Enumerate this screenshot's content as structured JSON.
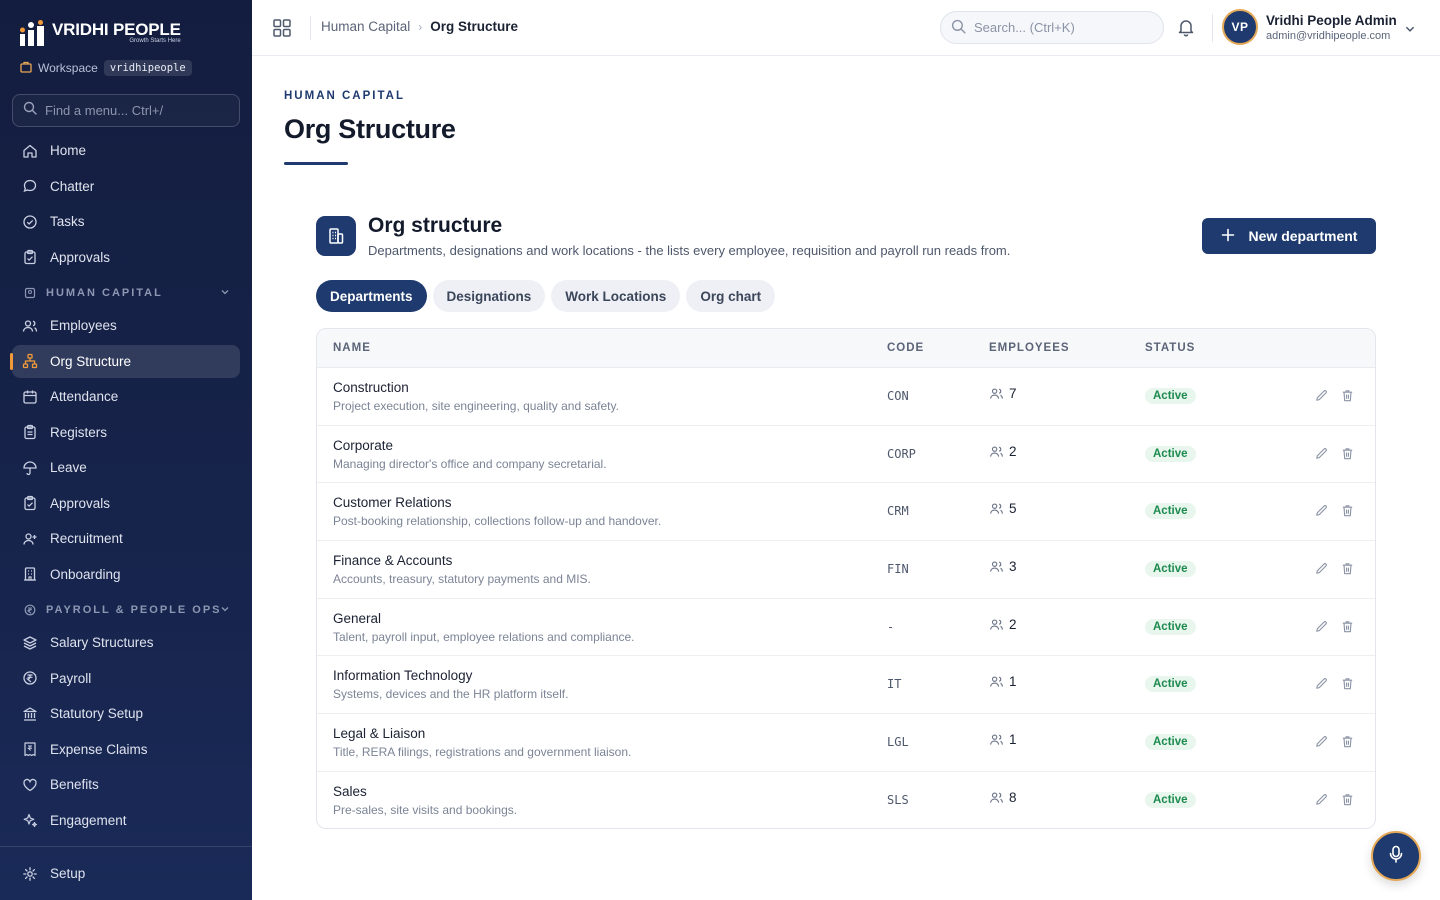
{
  "brand": {
    "name": "VRIDHI PEOPLE",
    "tagline": "Growth Starts Here"
  },
  "workspace": {
    "label": "Workspace",
    "slug": "vridhipeople"
  },
  "sidebar": {
    "search_placeholder": "Find a menu... Ctrl+/",
    "items_top": [
      {
        "label": "Home",
        "icon": "home-icon"
      },
      {
        "label": "Chatter",
        "icon": "chat-icon"
      },
      {
        "label": "Tasks",
        "icon": "check-circle-icon"
      },
      {
        "label": "Approvals",
        "icon": "clipboard-icon"
      }
    ],
    "section_hc": "HUMAN CAPITAL",
    "items_hc": [
      {
        "label": "Employees",
        "icon": "users-icon"
      },
      {
        "label": "Org Structure",
        "icon": "org-icon",
        "active": true
      },
      {
        "label": "Attendance",
        "icon": "calendar-icon"
      },
      {
        "label": "Registers",
        "icon": "clipboard-icon"
      },
      {
        "label": "Leave",
        "icon": "umbrella-icon"
      },
      {
        "label": "Approvals",
        "icon": "clipboard-icon"
      },
      {
        "label": "Recruitment",
        "icon": "user-plus-icon"
      },
      {
        "label": "Onboarding",
        "icon": "building-icon"
      }
    ],
    "section_pp": "PAYROLL & PEOPLE OPS",
    "items_pp": [
      {
        "label": "Salary Structures",
        "icon": "layers-icon"
      },
      {
        "label": "Payroll",
        "icon": "rupee-icon"
      },
      {
        "label": "Statutory Setup",
        "icon": "bank-icon"
      },
      {
        "label": "Expense Claims",
        "icon": "receipt-icon"
      },
      {
        "label": "Benefits",
        "icon": "heart-icon"
      },
      {
        "label": "Engagement",
        "icon": "sparkle-icon"
      }
    ],
    "footer_item": {
      "label": "Setup",
      "icon": "gear-icon"
    }
  },
  "topbar": {
    "breadcrumb": [
      "Human Capital",
      "Org Structure"
    ],
    "search_placeholder": "Search... (Ctrl+K)",
    "user": {
      "initials": "VP",
      "name": "Vridhi People Admin",
      "email": "admin@vridhipeople.com"
    }
  },
  "page": {
    "eyebrow": "HUMAN CAPITAL",
    "title": "Org Structure",
    "section_title": "Org structure",
    "section_subtitle": "Departments, designations and work locations - the lists every employee, requisition and payroll run reads from.",
    "new_button": "New department",
    "tabs": [
      "Departments",
      "Designations",
      "Work Locations",
      "Org chart"
    ],
    "active_tab": "Departments"
  },
  "table": {
    "columns": [
      "NAME",
      "CODE",
      "EMPLOYEES",
      "STATUS"
    ],
    "rows": [
      {
        "name": "Construction",
        "desc": "Project execution, site engineering, quality and safety.",
        "code": "CON",
        "employees": "7",
        "status": "Active"
      },
      {
        "name": "Corporate",
        "desc": "Managing director's office and company secretarial.",
        "code": "CORP",
        "employees": "2",
        "status": "Active"
      },
      {
        "name": "Customer Relations",
        "desc": "Post-booking relationship, collections follow-up and handover.",
        "code": "CRM",
        "employees": "5",
        "status": "Active"
      },
      {
        "name": "Finance & Accounts",
        "desc": "Accounts, treasury, statutory payments and MIS.",
        "code": "FIN",
        "employees": "3",
        "status": "Active"
      },
      {
        "name": "General",
        "desc": "Talent, payroll input, employee relations and compliance.",
        "code": "-",
        "employees": "2",
        "status": "Active"
      },
      {
        "name": "Information Technology",
        "desc": "Systems, devices and the HR platform itself.",
        "code": "IT",
        "employees": "1",
        "status": "Active"
      },
      {
        "name": "Legal & Liaison",
        "desc": "Title, RERA filings, registrations and government liaison.",
        "code": "LGL",
        "employees": "1",
        "status": "Active"
      },
      {
        "name": "Sales",
        "desc": "Pre-sales, site visits and bookings.",
        "code": "SLS",
        "employees": "8",
        "status": "Active"
      }
    ]
  },
  "colors": {
    "primary": "#1e3a6e",
    "accent": "#f29a3a",
    "success": "#1d8a4e"
  }
}
